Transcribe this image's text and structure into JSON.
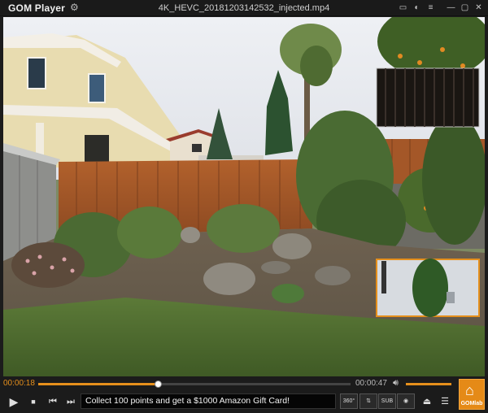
{
  "app": {
    "name": "GOM Player",
    "file_title": "4K_HEVC_20181203142532_injected.mp4"
  },
  "titlebar_icons": [
    "gear-icon",
    "minimize-icon",
    "maximize-icon",
    "close-icon"
  ],
  "playback": {
    "current_time": "00:00:18",
    "total_time": "00:00:47",
    "progress_fraction": 0.383,
    "volume_fraction": 1.0
  },
  "controls": {
    "buttons": [
      "play-icon",
      "stop-icon",
      "previous-icon",
      "next-icon"
    ],
    "promo_text": "Collect 100 points and get a $1000 Amazon Gift Card!",
    "right_buttons": [
      {
        "name": "360-view-button",
        "label": "360°"
      },
      {
        "name": "equalizer-button",
        "label": ""
      },
      {
        "name": "subtitle-button",
        "label": "SUB"
      },
      {
        "name": "capture-button",
        "label": ""
      },
      {
        "name": "eject-button",
        "label": ""
      },
      {
        "name": "menu-button",
        "label": ""
      }
    ],
    "gomlab_label": "GOMlab"
  },
  "colors": {
    "accent": "#e58f1c",
    "bar": "#1b1b1b"
  }
}
